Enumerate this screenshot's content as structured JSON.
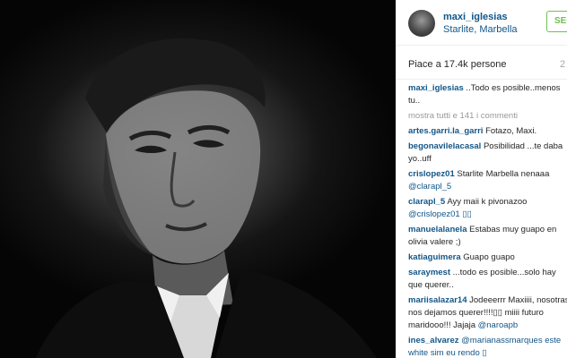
{
  "post": {
    "username": "maxi_iglesias",
    "location": "Starlite, Marbella",
    "follow_label": "SEGUI",
    "likes": "Piace a 17.4k persone",
    "time": "2",
    "view_all": "mostra tutti e 141 i commenti"
  },
  "comments": [
    {
      "user": "maxi_iglesias",
      "text": " ..Todo es posible..menos tu..",
      "mention": ""
    },
    {
      "user": "artes.garri.la_garri",
      "text": " Fotazo, Maxi.",
      "mention": ""
    },
    {
      "user": "begonavilelacasal",
      "text": " Posibilidad ...te daba yo..uff",
      "mention": ""
    },
    {
      "user": "crislopez01",
      "text": " Starlite Marbella nenaaa ",
      "mention": "@clarapl_5"
    },
    {
      "user": "clarapl_5",
      "text": " Ayy maii k pivonazoo ",
      "mention": "@crislopez01 ▯▯"
    },
    {
      "user": "manuelalanela",
      "text": " Estabas muy guapo en olivia valere ;)",
      "mention": ""
    },
    {
      "user": "katiaguimera",
      "text": " Guapo guapo",
      "mention": ""
    },
    {
      "user": "saraymest",
      "text": " ...todo es posible...solo hay que querer..",
      "mention": ""
    },
    {
      "user": "mariisalazar14",
      "text": " Jodeeerrr Maxiiii, nosotras nos dejamos querer!!!!▯▯ miiii futuro maridooo!!! Jajaja ",
      "mention": "@naroapb"
    },
    {
      "user": "ines_alvarez",
      "text": " ",
      "mention": "@marianassmarques este white sim eu rendo ▯"
    }
  ]
}
